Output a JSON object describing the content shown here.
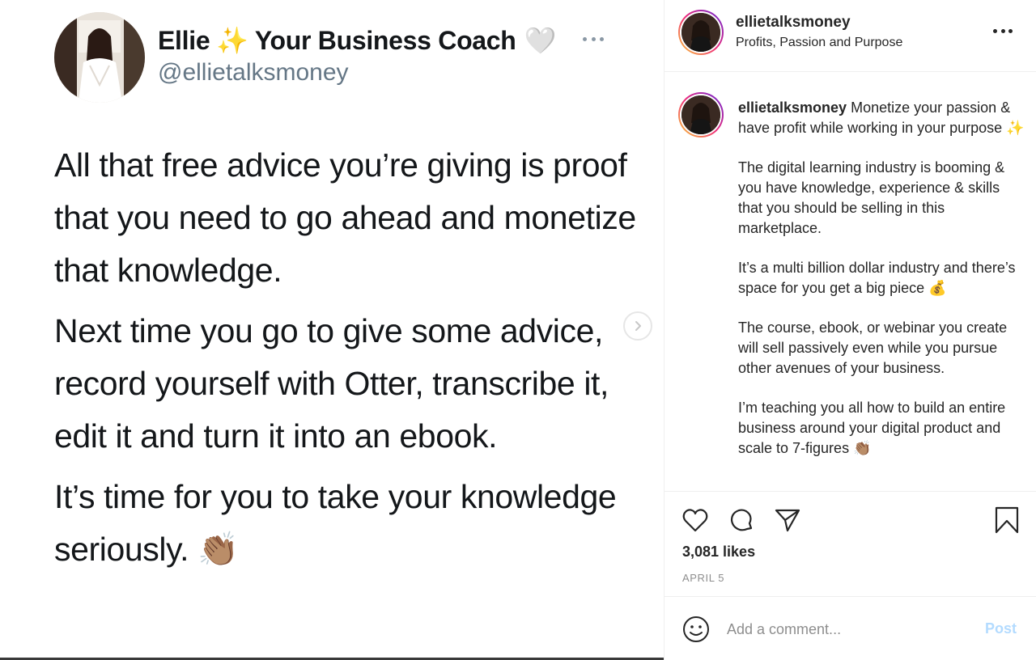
{
  "tweet": {
    "display_name": "Ellie",
    "name_sparkle": "✨",
    "name_rest": "Your Business Coach",
    "name_heart": "🤍",
    "handle": "@ellietalksmoney",
    "paragraphs": [
      "All that free advice you’re giving is proof that you need to go ahead and monetize that knowledge.",
      "Next time you go to give some advice, record yourself with Otter, transcribe it, edit it and turn it into an ebook.",
      "It’s time for you to take your knowledge seriously. 👏🏽"
    ]
  },
  "post": {
    "username": "ellietalksmoney",
    "subtitle": "Profits, Passion and Purpose",
    "caption_lead": "Monetize your passion & have profit while working in your purpose ✨",
    "caption_paragraphs": [
      "The digital learning industry is booming & you have knowledge, experience & skills that you should be selling in this marketplace.",
      "It’s a multi billion dollar industry and there’s space for you get a big piece 💰",
      "The course, ebook, or webinar you create will sell passively even while you pursue other avenues of your business.",
      "I’m teaching you all how to build an entire business around your digital product and scale to 7-figures 👏🏽"
    ],
    "likes": "3,081 likes",
    "date": "APRIL 5"
  },
  "comment": {
    "placeholder": "Add a comment...",
    "post_label": "Post"
  },
  "icons": {
    "like": "heart-icon",
    "comment": "comment-icon",
    "share": "paper-plane-icon",
    "save": "bookmark-icon",
    "emoji": "smiley-icon",
    "next": "chevron-right-icon",
    "more": "more-options-icon"
  },
  "colors": {
    "tweet_handle": "#657786",
    "post_button_disabled": "#b3dbff",
    "muted": "#8e8e8e"
  }
}
